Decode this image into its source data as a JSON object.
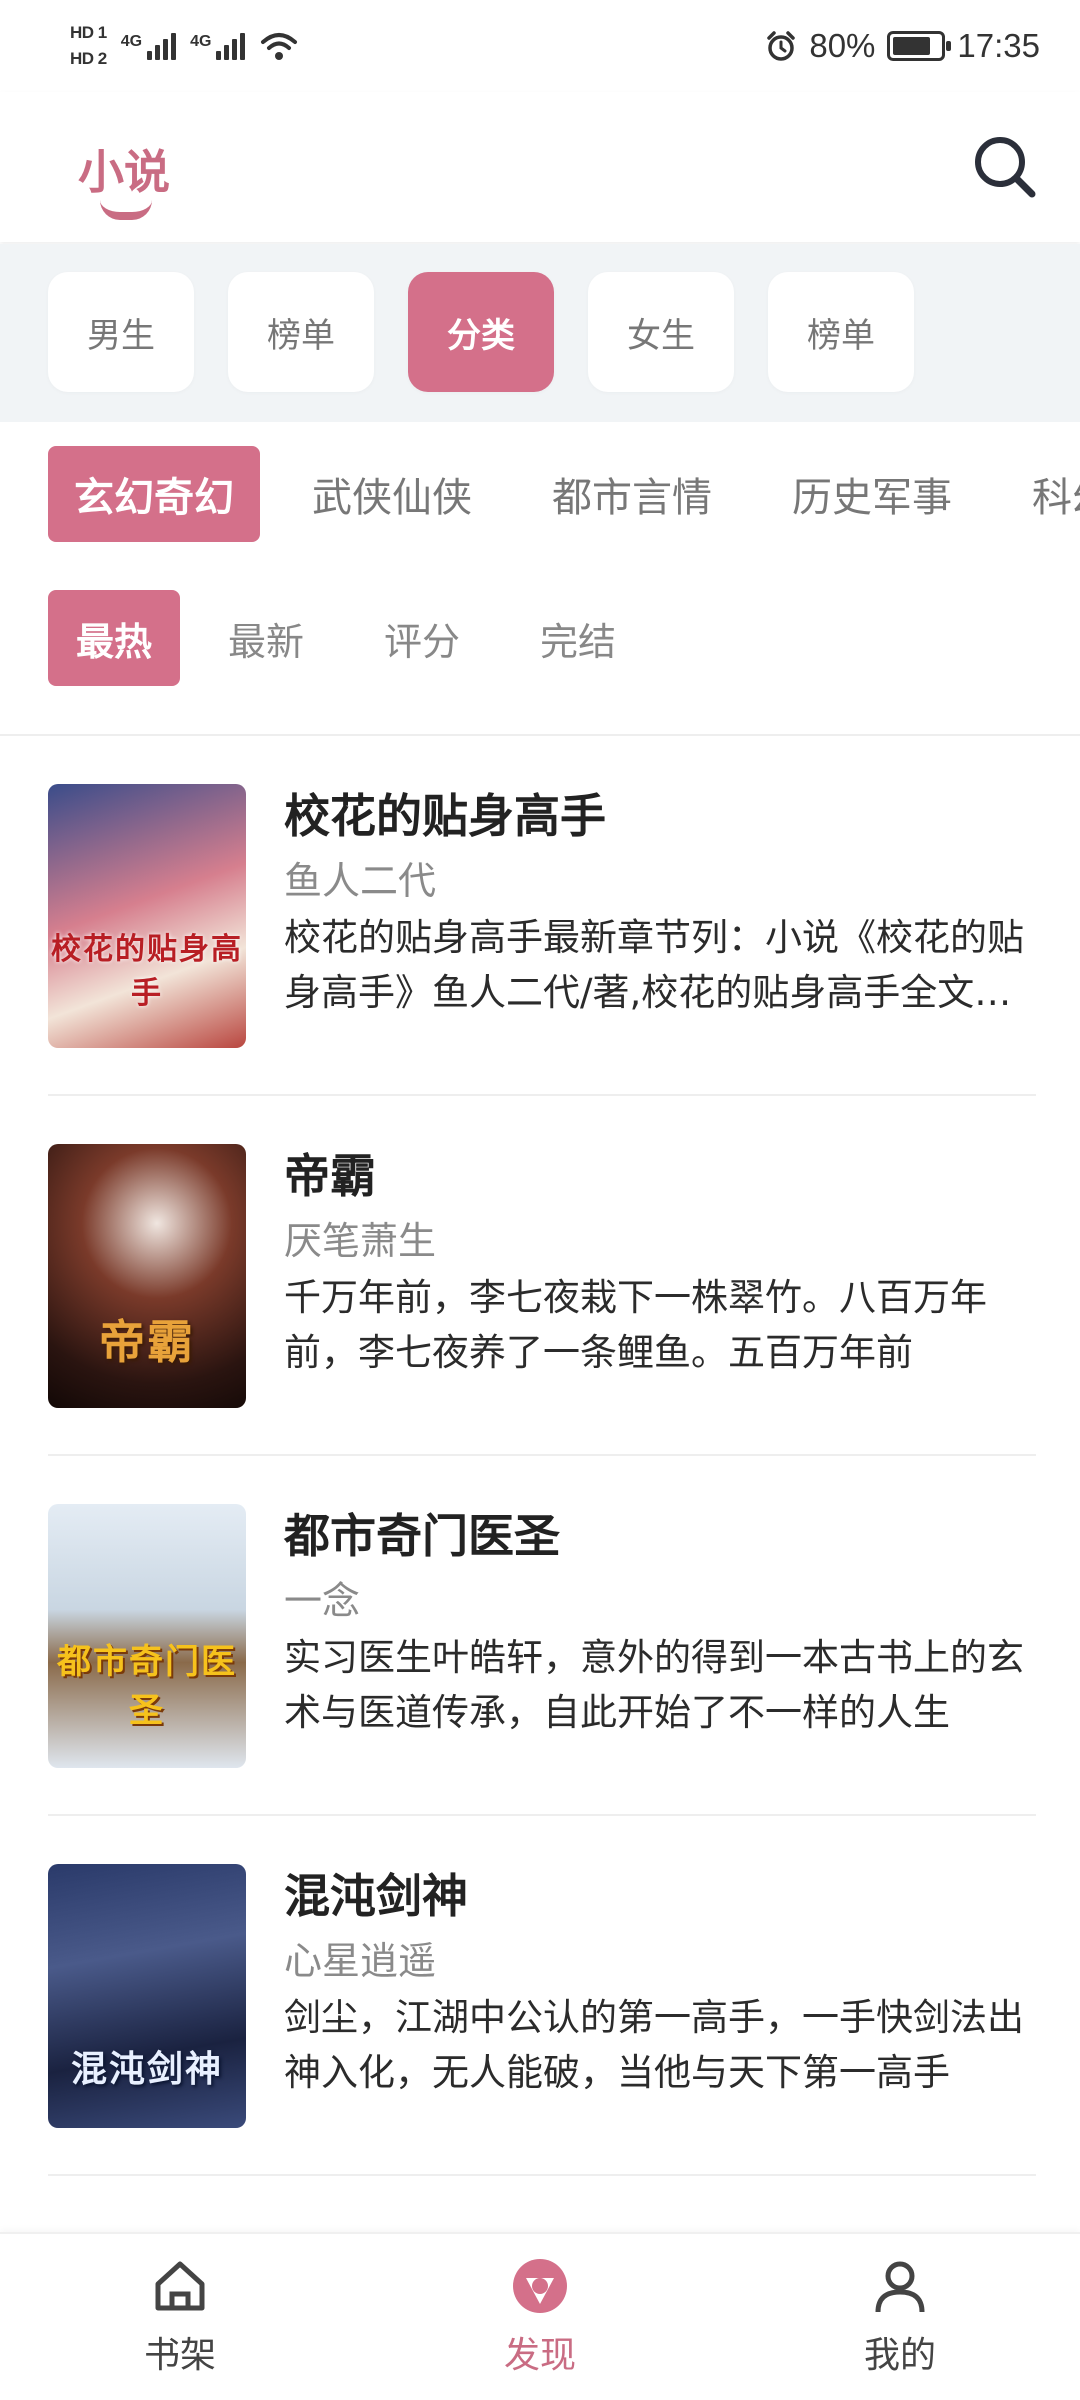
{
  "status_bar": {
    "hd1": "HD 1",
    "hd2": "HD 2",
    "net1": "4G",
    "net2": "4G",
    "battery_pct": "80%",
    "battery_level": 0.8,
    "time": "17:35"
  },
  "header": {
    "title": "小说",
    "search_icon": "search-icon"
  },
  "gender_tabs": [
    "男生",
    "榜单",
    "分类",
    "女生",
    "榜单"
  ],
  "gender_active": "分类",
  "categories": [
    "玄幻奇幻",
    "武侠仙侠",
    "都市言情",
    "历史军事",
    "科幻"
  ],
  "sort_tabs": [
    "最热",
    "最新",
    "评分",
    "完结"
  ],
  "books": [
    {
      "title": "校花的贴身高手",
      "author": "鱼人二代",
      "desc": "校花的贴身高手最新章节列：小说《校花的贴身高手》鱼人二代/著,校花的贴身高手全文阅读",
      "cover_text": "校花的贴身高手"
    },
    {
      "title": "帝霸",
      "author": "厌笔萧生",
      "desc": "千万年前，李七夜栽下一株翠竹。八百万年前，李七夜养了一条鲤鱼。五百万年前",
      "cover_text": "帝霸"
    },
    {
      "title": "都市奇门医圣",
      "author": "一念",
      "desc": "实习医生叶皓轩，意外的得到一本古书上的玄术与医道传承，自此开始了不一样的人生",
      "cover_text": "都市奇门医圣"
    },
    {
      "title": "混沌剑神",
      "author": "心星逍遥",
      "desc": "剑尘，江湖中公认的第一高手，一手快剑法出神入化，无人能破，当他与天下第一高手",
      "cover_text": "混沌剑神"
    }
  ],
  "bottom_nav": [
    {
      "label": "书架",
      "icon": "home-icon"
    },
    {
      "label": "发现",
      "icon": "discover-icon"
    },
    {
      "label": "我的",
      "icon": "profile-icon"
    }
  ],
  "colors": {
    "accent": "#d4708a",
    "accent_text": "#c96c83",
    "tab_bg": "#f1f4f6"
  }
}
